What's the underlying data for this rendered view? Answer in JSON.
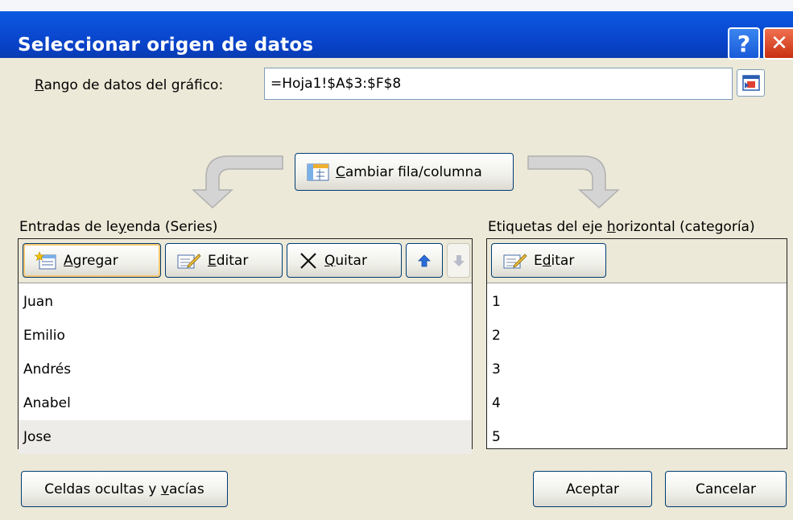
{
  "window": {
    "title": "Seleccionar origen de datos",
    "help_glyph": "?",
    "close_glyph": "✕"
  },
  "range": {
    "label": "Rango de datos del gráfico:",
    "value": "=Hoja1!$A$3:$F$8"
  },
  "switch_button": {
    "label": "Cambiar fila/columna"
  },
  "legend_panel": {
    "heading": "Entradas de leyenda (Series)",
    "buttons": {
      "add": "Agregar",
      "edit": "Editar",
      "remove": "Quitar"
    },
    "items": [
      "Juan",
      "Emilio",
      "Andrés",
      "Anabel",
      "Jose"
    ],
    "selected_index": 4
  },
  "axis_panel": {
    "heading": "Etiquetas del eje horizontal (categoría)",
    "buttons": {
      "edit": "Editar"
    },
    "items": [
      "1",
      "2",
      "3",
      "4",
      "5"
    ]
  },
  "footer": {
    "hidden_cells": "Celdas ocultas y vacías",
    "ok": "Aceptar",
    "cancel": "Cancelar"
  },
  "colors": {
    "titlebar": "#0a4cd4",
    "dialog_bg": "#ece9d8",
    "close_button": "#d84020"
  },
  "icons": [
    "help-icon",
    "close-icon",
    "collapse-dialog-icon",
    "switch-row-column-icon",
    "add-series-icon",
    "edit-icon",
    "remove-x-icon",
    "move-up-icon",
    "move-down-icon",
    "curved-arrow-left-icon",
    "curved-arrow-right-icon"
  ]
}
